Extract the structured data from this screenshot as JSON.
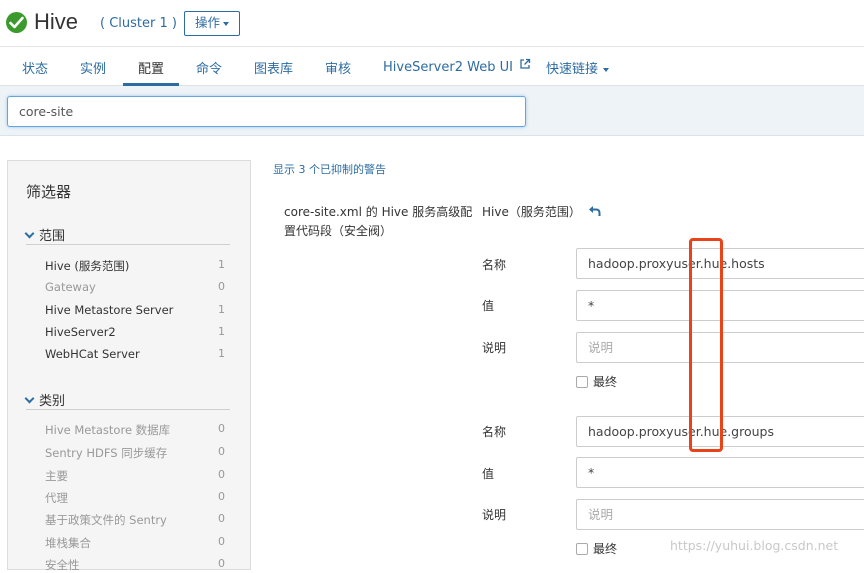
{
  "header": {
    "title": "Hive",
    "cluster": "( Cluster 1 )",
    "actions_label": "操作",
    "status_color": "#3c9a2d"
  },
  "tabs": [
    {
      "label": "状态"
    },
    {
      "label": "实例"
    },
    {
      "label": "配置"
    },
    {
      "label": "命令"
    },
    {
      "label": "图表库"
    },
    {
      "label": "审核"
    },
    {
      "label": "HiveServer2 Web UI"
    },
    {
      "label": "快速链接"
    }
  ],
  "search": {
    "value": "core-site"
  },
  "filters": {
    "title": "筛选器",
    "scope": {
      "heading": "范围",
      "items": [
        {
          "label": "Hive (服务范围)",
          "count": "1"
        },
        {
          "label": "Gateway",
          "count": "0"
        },
        {
          "label": "Hive Metastore Server",
          "count": "1"
        },
        {
          "label": "HiveServer2",
          "count": "1"
        },
        {
          "label": "WebHCat Server",
          "count": "1"
        }
      ]
    },
    "category": {
      "heading": "类别",
      "items": [
        {
          "label": "Hive Metastore 数据库",
          "count": "0"
        },
        {
          "label": "Sentry HDFS 同步缓存",
          "count": "0"
        },
        {
          "label": "主要",
          "count": "0"
        },
        {
          "label": "代理",
          "count": "0"
        },
        {
          "label": "基于政策文件的 Sentry",
          "count": "0"
        },
        {
          "label": "堆栈集合",
          "count": "0"
        },
        {
          "label": "安全性",
          "count": "0"
        }
      ]
    }
  },
  "main": {
    "warnings_link": "显示 3 个已抑制的警告",
    "property_name": "core-site.xml 的 Hive 服务高级配置代码段（安全阀）",
    "scope_label": "Hive（服务范围）",
    "entries": [
      {
        "name_label": "名称",
        "name_value": "hadoop.proxyuser.hue.hosts",
        "value_label": "值",
        "value_value": "*",
        "desc_label": "说明",
        "desc_placeholder": "说明",
        "final_label": "最终"
      },
      {
        "name_label": "名称",
        "name_value": "hadoop.proxyuser.hue.groups",
        "value_label": "值",
        "value_value": "*",
        "desc_label": "说明",
        "desc_placeholder": "说明",
        "final_label": "最终"
      }
    ]
  },
  "watermark": "https://yuhui.blog.csdn.net",
  "colors": {
    "link": "#2d6ca2",
    "highlight": "#e8431a"
  }
}
